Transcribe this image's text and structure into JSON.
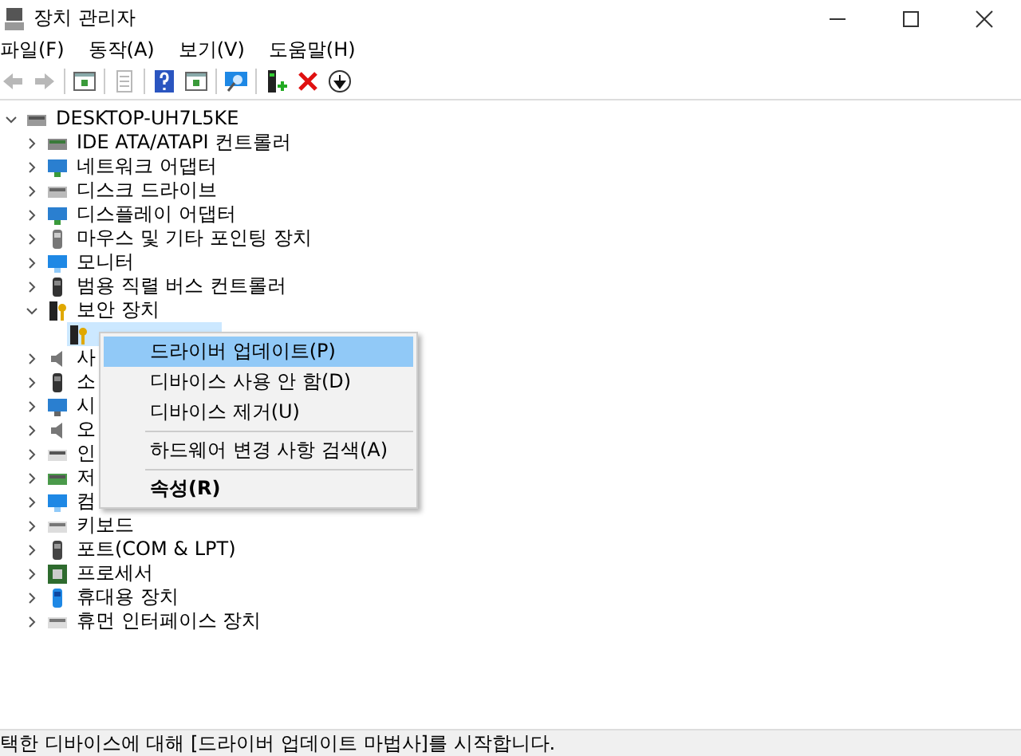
{
  "window": {
    "title": "장치 관리자"
  },
  "menu_bar": [
    {
      "label": "파일(F)"
    },
    {
      "label": "동작(A)"
    },
    {
      "label": "보기(V)"
    },
    {
      "label": "도움말(H)"
    }
  ],
  "toolbar": [
    {
      "kind": "back",
      "disabled": true
    },
    {
      "kind": "forward",
      "disabled": true
    },
    {
      "kind": "separator"
    },
    {
      "kind": "pane",
      "disabled": false
    },
    {
      "kind": "separator"
    },
    {
      "kind": "page",
      "disabled": true
    },
    {
      "kind": "separator"
    },
    {
      "kind": "help",
      "disabled": false
    },
    {
      "kind": "pane2",
      "disabled": false
    },
    {
      "kind": "separator"
    },
    {
      "kind": "scan",
      "disabled": false
    },
    {
      "kind": "separator"
    },
    {
      "kind": "update",
      "disabled": false
    },
    {
      "kind": "remove",
      "disabled": false
    },
    {
      "kind": "disable",
      "disabled": false
    }
  ],
  "tree": {
    "label": "DESKTOP-UH7L5KE",
    "kind": "computer",
    "expanded": true,
    "selected": false,
    "children": [
      {
        "label": "IDE ATA/ATAPI 컨트롤러",
        "kind": "controller",
        "expanded": false,
        "selected": false
      },
      {
        "label": "네트워크 어댑터",
        "kind": "network",
        "expanded": false,
        "selected": false
      },
      {
        "label": "디스크 드라이브",
        "kind": "disk",
        "expanded": false,
        "selected": false
      },
      {
        "label": "디스플레이 어댑터",
        "kind": "display",
        "expanded": false,
        "selected": false
      },
      {
        "label": "마우스 및 기타 포인팅 장치",
        "kind": "mouse",
        "expanded": false,
        "selected": false
      },
      {
        "label": "모니터",
        "kind": "monitor",
        "expanded": false,
        "selected": false
      },
      {
        "label": "범용 직렬 버스 컨트롤러",
        "kind": "usb",
        "expanded": false,
        "selected": false
      },
      {
        "label": "보안 장치",
        "kind": "security",
        "expanded": true,
        "selected": false,
        "children": [
          {
            "kind": "security",
            "selected": true
          }
        ]
      },
      {
        "label": "사",
        "kind": "sound",
        "expanded": false,
        "selected": false
      },
      {
        "label": "소",
        "kind": "usb",
        "expanded": false,
        "selected": false
      },
      {
        "label": "시",
        "kind": "system",
        "expanded": false,
        "selected": false
      },
      {
        "label": "오",
        "kind": "sound",
        "expanded": false,
        "selected": false
      },
      {
        "label": "인",
        "kind": "printer",
        "expanded": false,
        "selected": false
      },
      {
        "label": "저",
        "kind": "storage",
        "expanded": false,
        "selected": false
      },
      {
        "label": "컴",
        "kind": "monitor",
        "expanded": false,
        "selected": false
      },
      {
        "label": "키보드",
        "kind": "keyboard",
        "expanded": false,
        "selected": false
      },
      {
        "label": "포트(COM & LPT)",
        "kind": "port",
        "expanded": false,
        "selected": false
      },
      {
        "label": "프로세서",
        "kind": "processor",
        "expanded": false,
        "selected": false
      },
      {
        "label": "휴대용 장치",
        "kind": "portable",
        "expanded": false,
        "selected": false
      },
      {
        "label": "휴먼 인터페이스 장치",
        "kind": "keyboard",
        "expanded": false,
        "selected": false
      }
    ]
  },
  "context_menu": [
    {
      "kind": "item",
      "label": "드라이버 업데이트(P)",
      "selected": true,
      "default": false
    },
    {
      "kind": "item",
      "label": "디바이스 사용 안 함(D)",
      "selected": false,
      "default": false
    },
    {
      "kind": "item",
      "label": "디바이스 제거(U)",
      "selected": false,
      "default": false
    },
    {
      "kind": "separator"
    },
    {
      "kind": "item",
      "label": "하드웨어 변경 사항 검색(A)",
      "selected": false,
      "default": false
    },
    {
      "kind": "separator"
    },
    {
      "kind": "item",
      "label": "속성(R)",
      "selected": false,
      "default": true
    }
  ],
  "status_bar": {
    "text": "택한 디바이스에 대해 [드라이버 업데이트 마법사]를 시작합니다."
  }
}
